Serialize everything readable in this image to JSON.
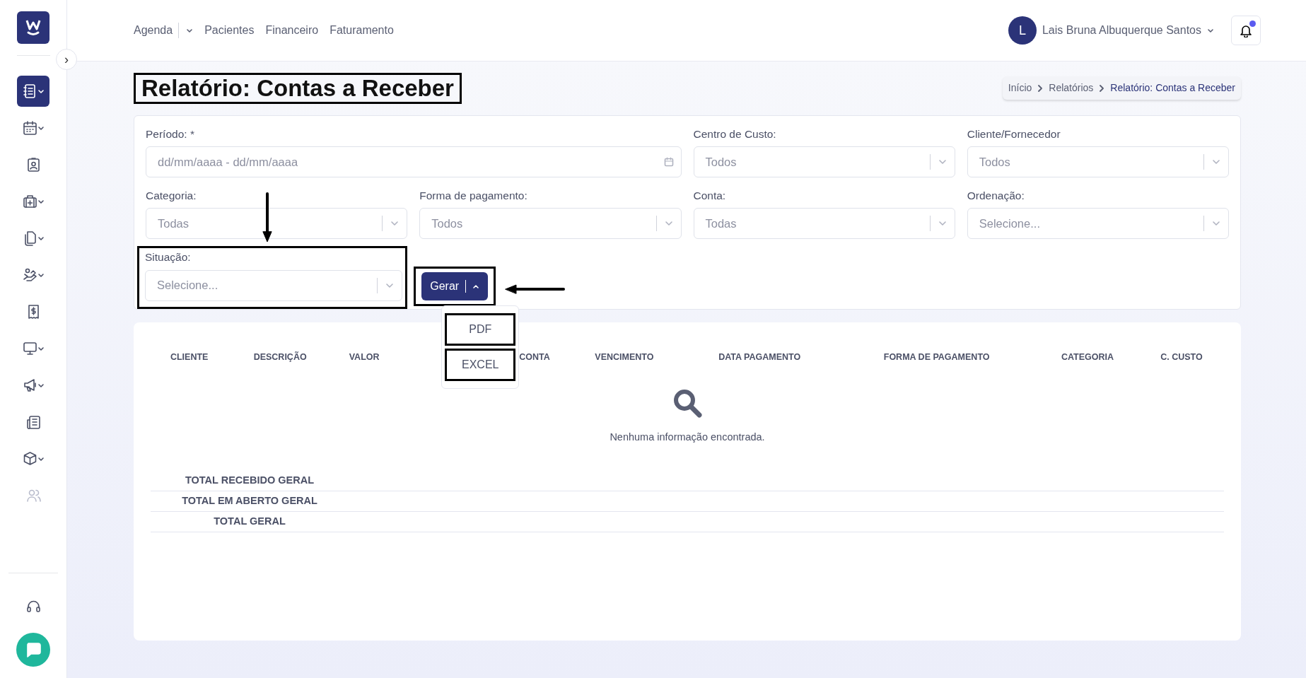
{
  "sidebar": {
    "collapse_button": "›",
    "items": [
      {
        "expandable": true,
        "selected": true,
        "disabled": false
      },
      {
        "expandable": true,
        "selected": false,
        "disabled": false
      },
      {
        "expandable": false,
        "selected": false,
        "disabled": false
      },
      {
        "expandable": true,
        "selected": false,
        "disabled": false
      },
      {
        "expandable": true,
        "selected": false,
        "disabled": false
      },
      {
        "expandable": true,
        "selected": false,
        "disabled": false
      },
      {
        "expandable": false,
        "selected": false,
        "disabled": false
      },
      {
        "expandable": true,
        "selected": false,
        "disabled": false
      },
      {
        "expandable": true,
        "selected": false,
        "disabled": false
      },
      {
        "expandable": false,
        "selected": false,
        "disabled": false
      },
      {
        "expandable": true,
        "selected": false,
        "disabled": false
      },
      {
        "expandable": false,
        "selected": false,
        "disabled": true
      }
    ]
  },
  "nav": [
    {
      "label": "Agenda",
      "dropdown": true
    },
    {
      "label": "Pacientes",
      "dropdown": false
    },
    {
      "label": "Financeiro",
      "dropdown": false
    },
    {
      "label": "Faturamento",
      "dropdown": false
    }
  ],
  "user": {
    "initial": "L",
    "name": "Lais Bruna Albuquerque Santos",
    "notification": true
  },
  "page_title": "Relatório: Contas a Receber",
  "breadcrumb": [
    {
      "label": "Início",
      "current": false
    },
    {
      "label": "Relatórios",
      "current": false
    },
    {
      "label": "Relatório: Contas a Receber",
      "current": true
    }
  ],
  "filters": [
    {
      "kind": "date",
      "label": "Período: *",
      "placeholder": "dd/mm/aaaa - dd/mm/aaaa",
      "wide": true,
      "highlighted": false
    },
    {
      "kind": "select",
      "label": "Centro de Custo:",
      "placeholder": "Todos",
      "wide": false,
      "highlighted": false
    },
    {
      "kind": "select",
      "label": "Cliente/Fornecedor",
      "placeholder": "Todos",
      "wide": false,
      "highlighted": false
    },
    {
      "kind": "select",
      "label": "Categoria:",
      "placeholder": "Todas",
      "wide": false,
      "highlighted": false
    },
    {
      "kind": "select",
      "label": "Forma de pagamento:",
      "placeholder": "Todos",
      "wide": false,
      "highlighted": false
    },
    {
      "kind": "select",
      "label": "Conta:",
      "placeholder": "Todas",
      "wide": false,
      "highlighted": false
    },
    {
      "kind": "select",
      "label": "Ordenação:",
      "placeholder": "Selecione...",
      "wide": false,
      "highlighted": false
    },
    {
      "kind": "select",
      "label": "Situação:",
      "placeholder": "Selecione...",
      "wide": false,
      "highlighted": true
    }
  ],
  "generate": {
    "label": "Gerar",
    "expanded": true,
    "highlighted": true,
    "menu": [
      {
        "label": "PDF",
        "highlighted": true
      },
      {
        "label": "EXCEL",
        "highlighted": true
      }
    ]
  },
  "table": {
    "columns": [
      "CLIENTE",
      "DESCRIÇÃO",
      "VALOR",
      null,
      "CONTA",
      "VENCIMENTO",
      "DATA PAGAMENTO",
      "FORMA DE PAGAMENTO",
      "CATEGORIA",
      "C. CUSTO"
    ],
    "empty_message": "Nenhuma informação encontrada.",
    "totals": [
      "TOTAL RECEBIDO GERAL",
      "TOTAL EM ABERTO GERAL",
      "TOTAL GERAL"
    ]
  },
  "title_highlighted": true
}
